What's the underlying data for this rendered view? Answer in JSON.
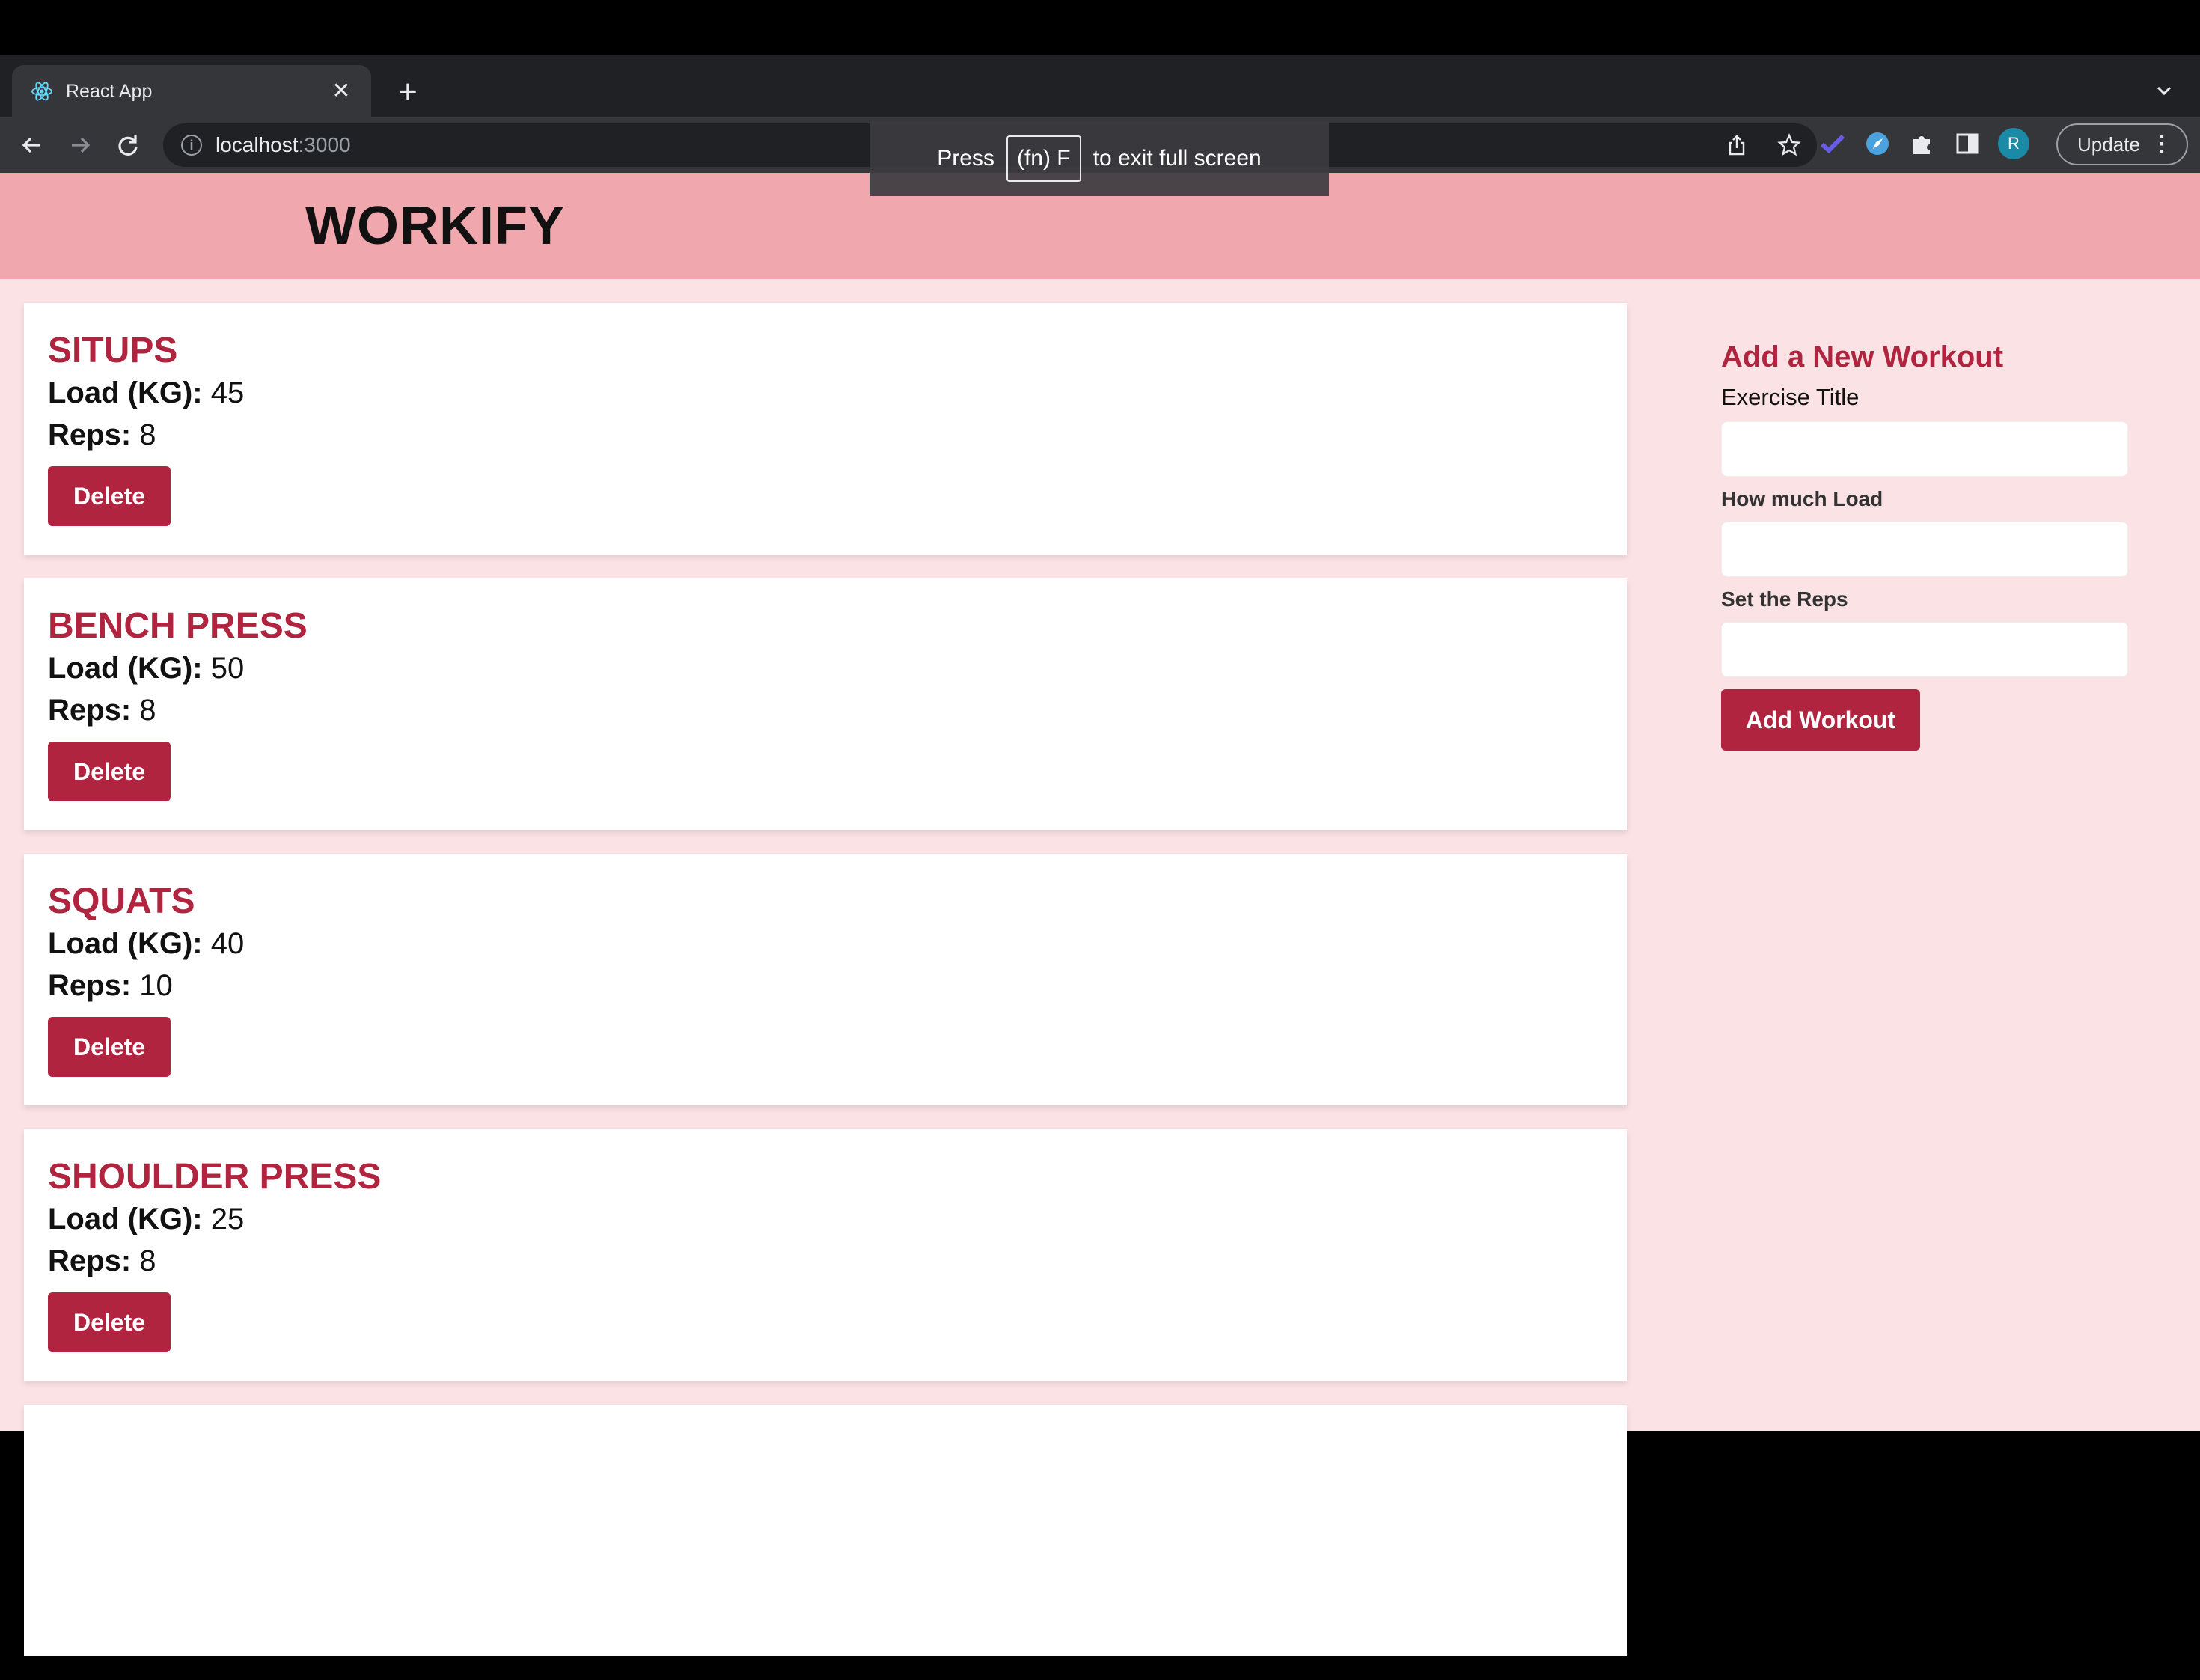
{
  "browser": {
    "tab": {
      "title": "React App",
      "close": "✕"
    },
    "new_tab": "+",
    "url": {
      "host": "localhost",
      "port": ":3000"
    },
    "update_label": "Update",
    "avatar_initial": "R",
    "fullscreen_toast": {
      "prefix": "Press",
      "key": "(fn) F",
      "suffix": "to exit full screen"
    }
  },
  "app": {
    "brand": "WORKIFY",
    "workouts": [
      {
        "title": "SITUPS",
        "load_label": "Load (KG):",
        "load": "45",
        "reps_label": "Reps:",
        "reps": "8",
        "delete_label": "Delete"
      },
      {
        "title": "BENCH PRESS",
        "load_label": "Load (KG):",
        "load": "50",
        "reps_label": "Reps:",
        "reps": "8",
        "delete_label": "Delete"
      },
      {
        "title": "SQUATS",
        "load_label": "Load (KG):",
        "load": "40",
        "reps_label": "Reps:",
        "reps": "10",
        "delete_label": "Delete"
      },
      {
        "title": "SHOULDER PRESS",
        "load_label": "Load (KG):",
        "load": "25",
        "reps_label": "Reps:",
        "reps": "8",
        "delete_label": "Delete"
      }
    ],
    "form": {
      "title": "Add a New Workout",
      "title_label": "Exercise Title",
      "load_label": "How much Load",
      "reps_label": "Set the Reps",
      "title_value": "",
      "load_value": "",
      "reps_value": "",
      "submit_label": "Add Workout"
    }
  },
  "colors": {
    "accent": "#b0243f",
    "header_bg": "#f0a8ae",
    "page_bg": "#fbe2e4"
  }
}
